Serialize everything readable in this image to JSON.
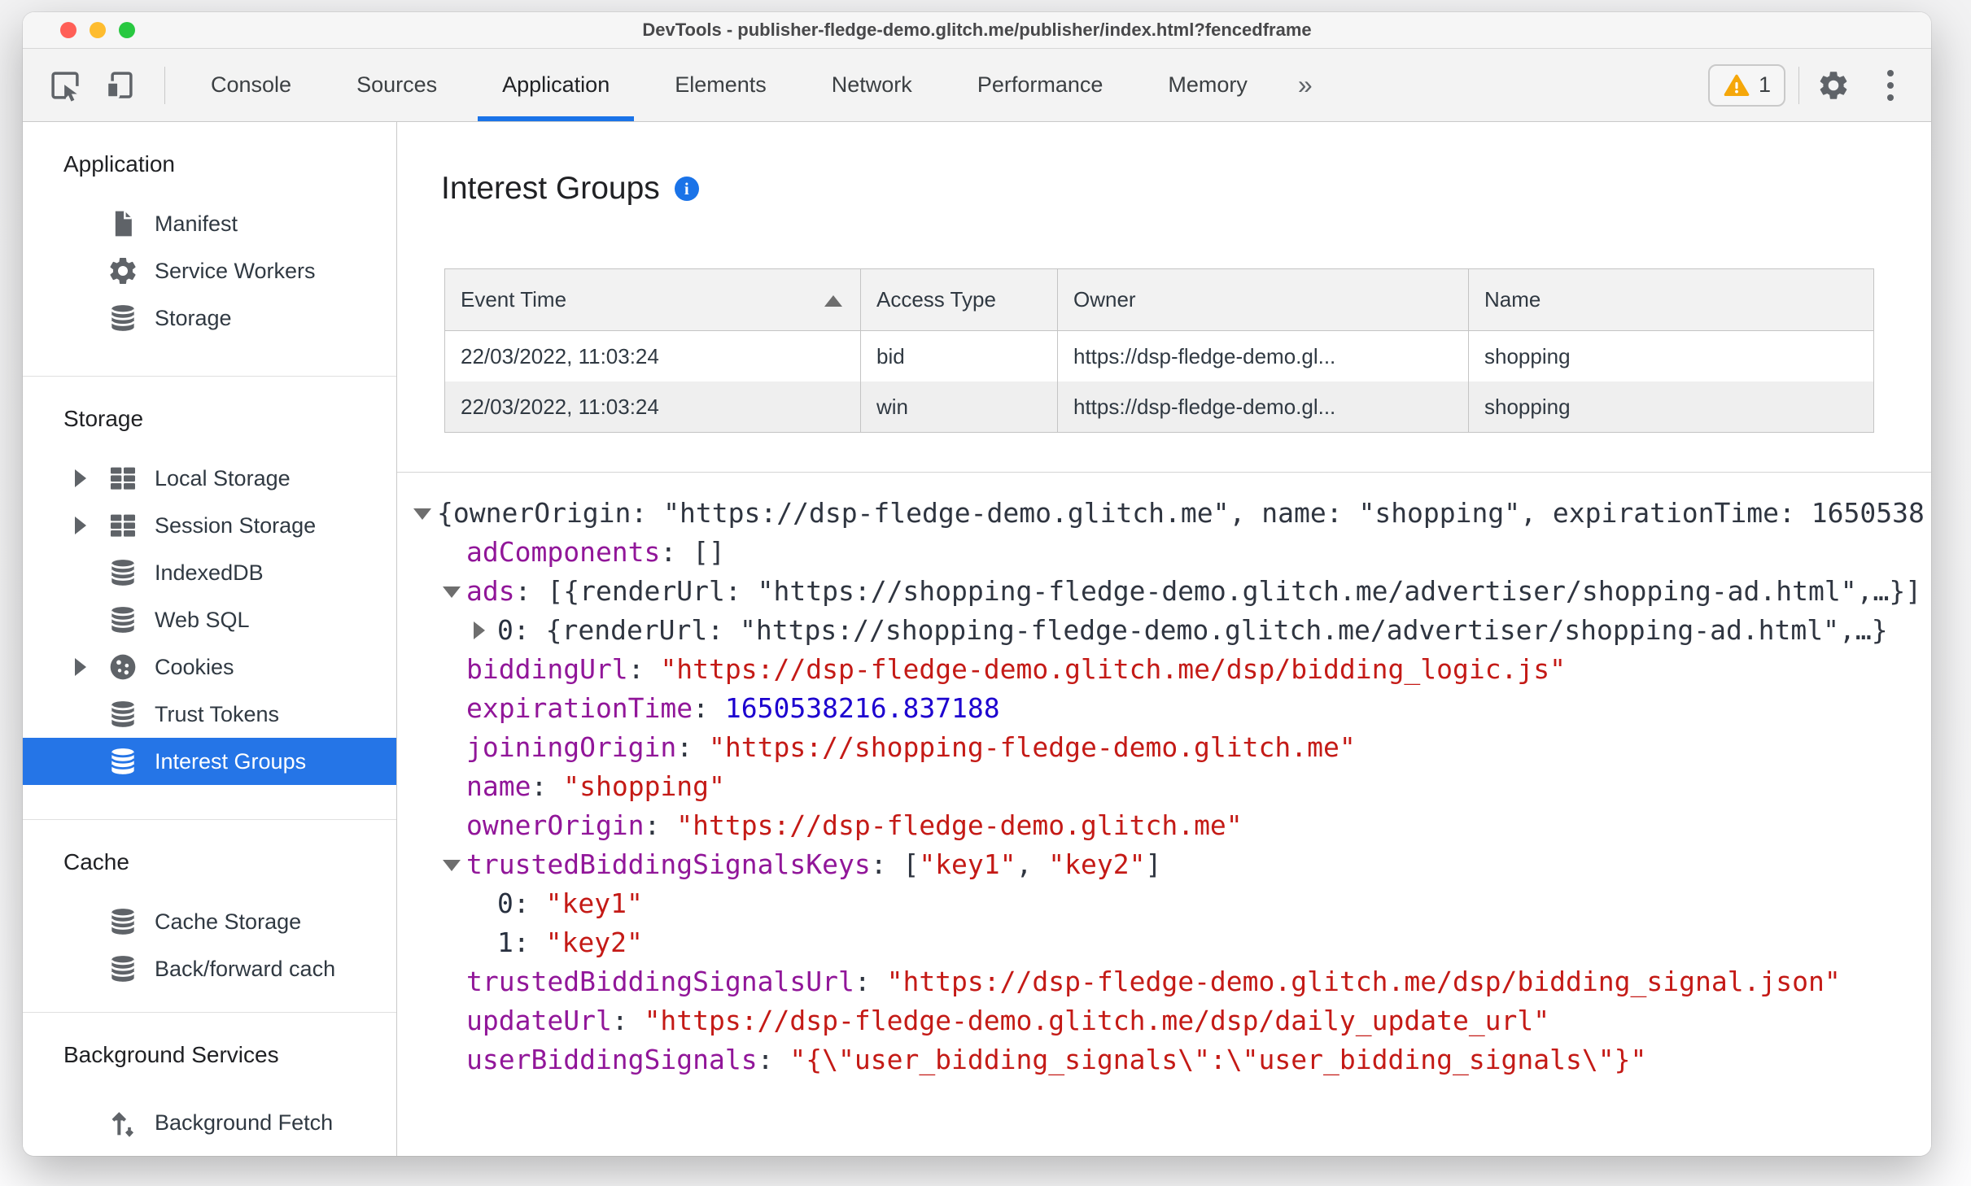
{
  "window": {
    "title": "DevTools - publisher-fledge-demo.glitch.me/publisher/index.html?fencedframe"
  },
  "colors": {
    "accent_blue": "#1a73e8",
    "selection_blue": "#2575e7",
    "warning_yellow": "#f5a70a",
    "json_key_purple": "#911699",
    "json_string_red": "#c41a16",
    "json_number_blue": "#1c00cf"
  },
  "toolbar": {
    "icons": [
      "inspect-icon",
      "device-toolbar-icon",
      "gear-icon",
      "kebab-menu-icon"
    ],
    "tabs": [
      {
        "label": "Console",
        "active": false
      },
      {
        "label": "Sources",
        "active": false
      },
      {
        "label": "Application",
        "active": true
      },
      {
        "label": "Elements",
        "active": false
      },
      {
        "label": "Network",
        "active": false
      },
      {
        "label": "Performance",
        "active": false
      },
      {
        "label": "Memory",
        "active": false
      }
    ],
    "more_label": "»",
    "warning_count": "1"
  },
  "sidebar": {
    "sections": [
      {
        "title": "Application",
        "items": [
          {
            "label": "Manifest",
            "icon": "document-icon"
          },
          {
            "label": "Service Workers",
            "icon": "gear-icon"
          },
          {
            "label": "Storage",
            "icon": "database-icon"
          }
        ]
      },
      {
        "title": "Storage",
        "items": [
          {
            "label": "Local Storage",
            "icon": "table-icon",
            "expandable": true
          },
          {
            "label": "Session Storage",
            "icon": "table-icon",
            "expandable": true
          },
          {
            "label": "IndexedDB",
            "icon": "database-icon"
          },
          {
            "label": "Web SQL",
            "icon": "database-icon"
          },
          {
            "label": "Cookies",
            "icon": "cookie-icon",
            "expandable": true
          },
          {
            "label": "Trust Tokens",
            "icon": "database-icon"
          },
          {
            "label": "Interest Groups",
            "icon": "database-icon",
            "selected": true
          }
        ]
      },
      {
        "title": "Cache",
        "items": [
          {
            "label": "Cache Storage",
            "icon": "database-icon"
          },
          {
            "label": "Back/forward cach",
            "icon": "database-icon"
          }
        ]
      },
      {
        "title": "Background Services",
        "items": [
          {
            "label": "Background Fetch",
            "icon": "background-fetch-icon"
          }
        ]
      }
    ]
  },
  "main": {
    "title": "Interest Groups",
    "table": {
      "columns": [
        "Event Time",
        "Access Type",
        "Owner",
        "Name"
      ],
      "sort_column": "Event Time",
      "sort_direction": "ascending",
      "rows": [
        [
          "22/03/2022, 11:03:24",
          "bid",
          "https://dsp-fledge-demo.gl...",
          "shopping"
        ],
        [
          "22/03/2022, 11:03:24",
          "win",
          "https://dsp-fledge-demo.gl...",
          "shopping"
        ]
      ]
    },
    "tree": {
      "lines": [
        {
          "indent": 0,
          "expander": "open",
          "segments": [
            {
              "c": "plain",
              "t": "{ownerOrigin: \"https://dsp-fledge-demo.glitch.me\", name: \"shopping\", expirationTime: 1650538"
            }
          ]
        },
        {
          "indent": 1,
          "expander": null,
          "segments": [
            {
              "c": "key",
              "t": "adComponents"
            },
            {
              "c": "plain",
              "t": ": []"
            }
          ]
        },
        {
          "indent": 1,
          "expander": "open",
          "segments": [
            {
              "c": "key",
              "t": "ads"
            },
            {
              "c": "plain",
              "t": ": [{renderUrl: \"https://shopping-fledge-demo.glitch.me/advertiser/shopping-ad.html\",…}]"
            }
          ]
        },
        {
          "indent": 2,
          "expander": "closed",
          "segments": [
            {
              "c": "idx",
              "t": "0"
            },
            {
              "c": "plain",
              "t": ": {renderUrl: \"https://shopping-fledge-demo.glitch.me/advertiser/shopping-ad.html\",…}"
            }
          ]
        },
        {
          "indent": 1,
          "expander": null,
          "segments": [
            {
              "c": "key",
              "t": "biddingUrl"
            },
            {
              "c": "plain",
              "t": ": "
            },
            {
              "c": "str",
              "t": "\"https://dsp-fledge-demo.glitch.me/dsp/bidding_logic.js\""
            }
          ]
        },
        {
          "indent": 1,
          "expander": null,
          "segments": [
            {
              "c": "key",
              "t": "expirationTime"
            },
            {
              "c": "plain",
              "t": ": "
            },
            {
              "c": "num",
              "t": "1650538216.837188"
            }
          ]
        },
        {
          "indent": 1,
          "expander": null,
          "segments": [
            {
              "c": "key",
              "t": "joiningOrigin"
            },
            {
              "c": "plain",
              "t": ": "
            },
            {
              "c": "str",
              "t": "\"https://shopping-fledge-demo.glitch.me\""
            }
          ]
        },
        {
          "indent": 1,
          "expander": null,
          "segments": [
            {
              "c": "key",
              "t": "name"
            },
            {
              "c": "plain",
              "t": ": "
            },
            {
              "c": "str",
              "t": "\"shopping\""
            }
          ]
        },
        {
          "indent": 1,
          "expander": null,
          "segments": [
            {
              "c": "key",
              "t": "ownerOrigin"
            },
            {
              "c": "plain",
              "t": ": "
            },
            {
              "c": "str",
              "t": "\"https://dsp-fledge-demo.glitch.me\""
            }
          ]
        },
        {
          "indent": 1,
          "expander": "open",
          "segments": [
            {
              "c": "key",
              "t": "trustedBiddingSignalsKeys"
            },
            {
              "c": "plain",
              "t": ": ["
            },
            {
              "c": "str",
              "t": "\"key1\""
            },
            {
              "c": "plain",
              "t": ", "
            },
            {
              "c": "str",
              "t": "\"key2\""
            },
            {
              "c": "plain",
              "t": "]"
            }
          ]
        },
        {
          "indent": 2,
          "expander": null,
          "segments": [
            {
              "c": "idx",
              "t": "0"
            },
            {
              "c": "plain",
              "t": ": "
            },
            {
              "c": "str",
              "t": "\"key1\""
            }
          ]
        },
        {
          "indent": 2,
          "expander": null,
          "segments": [
            {
              "c": "idx",
              "t": "1"
            },
            {
              "c": "plain",
              "t": ": "
            },
            {
              "c": "str",
              "t": "\"key2\""
            }
          ]
        },
        {
          "indent": 1,
          "expander": null,
          "segments": [
            {
              "c": "key",
              "t": "trustedBiddingSignalsUrl"
            },
            {
              "c": "plain",
              "t": ": "
            },
            {
              "c": "str",
              "t": "\"https://dsp-fledge-demo.glitch.me/dsp/bidding_signal.json\""
            }
          ]
        },
        {
          "indent": 1,
          "expander": null,
          "segments": [
            {
              "c": "key",
              "t": "updateUrl"
            },
            {
              "c": "plain",
              "t": ": "
            },
            {
              "c": "str",
              "t": "\"https://dsp-fledge-demo.glitch.me/dsp/daily_update_url\""
            }
          ]
        },
        {
          "indent": 1,
          "expander": null,
          "segments": [
            {
              "c": "key",
              "t": "userBiddingSignals"
            },
            {
              "c": "plain",
              "t": ": "
            },
            {
              "c": "str",
              "t": "\"{\\\"user_bidding_signals\\\":\\\"user_bidding_signals\\\"}\""
            }
          ]
        }
      ]
    }
  }
}
